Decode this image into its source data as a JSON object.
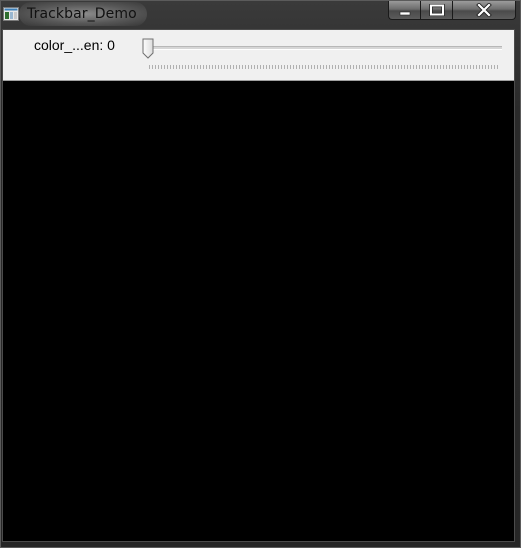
{
  "window": {
    "title": "Trackbar_Demo",
    "icon": "opencv-window-icon"
  },
  "caption_buttons": {
    "minimize_icon": "minimize-icon",
    "maximize_icon": "maximize-icon",
    "close_icon": "close-icon"
  },
  "trackbar": {
    "name": "color_...en",
    "separator": ": ",
    "value": "0",
    "position_fraction": 0
  },
  "canvas": {
    "background_color": "#000000"
  }
}
